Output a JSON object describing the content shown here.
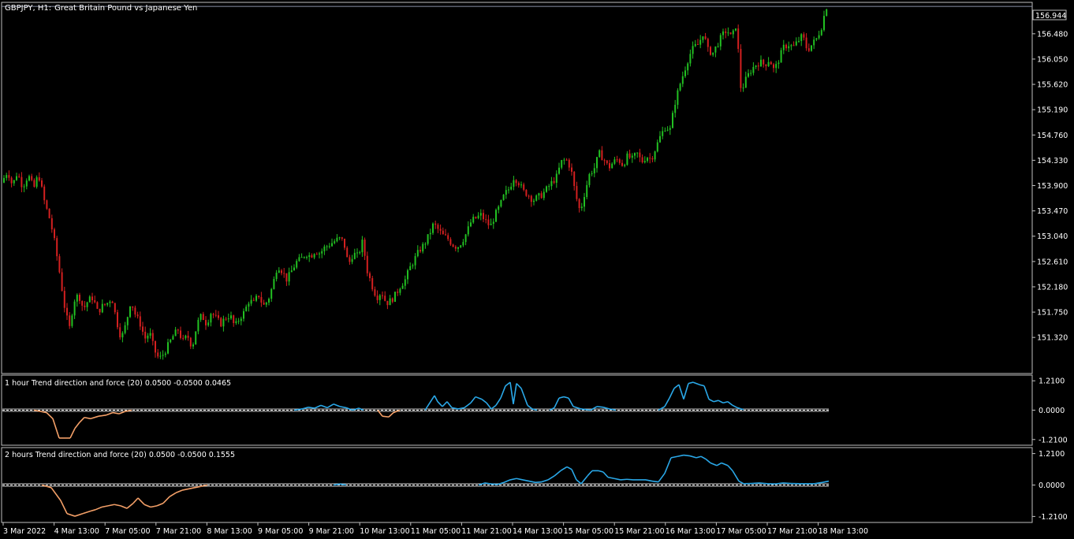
{
  "header": {
    "symbol_timeframe": "GBPJPY, H1:",
    "description": "Great Britain Pound vs Japanese Yen"
  },
  "colors": {
    "background": "#000000",
    "bull_candle": "#22c022",
    "bear_candle": "#d42020",
    "axis_text": "#ffffff",
    "frame": "#c0c0c0",
    "price_line": "#8a8fa6",
    "positive_line": "#2aa8e8",
    "negative_line": "#f4a068",
    "zero_band": "#c0c0c0"
  },
  "main_panel": {
    "current_price": "156.944",
    "y_ticks": [
      "156.480",
      "156.050",
      "155.620",
      "155.190",
      "154.760",
      "154.330",
      "153.900",
      "153.470",
      "153.040",
      "152.610",
      "152.180",
      "151.750",
      "151.320"
    ]
  },
  "indicators": [
    {
      "label": "1 hour Trend direction and force (20) 0.0500 -0.0500 0.0465",
      "y_ticks": [
        "1.2100",
        "0.0000",
        "-1.2100"
      ]
    },
    {
      "label": "2 hours Trend direction and force (20) 0.0500 -0.0500 0.1555",
      "y_ticks": [
        "1.2100",
        "0.0000",
        "-1.2100"
      ]
    }
  ],
  "x_axis": {
    "ticks": [
      "3 Mar 2022",
      "4 Mar 13:00",
      "7 Mar 05:00",
      "7 Mar 21:00",
      "8 Mar 13:00",
      "9 Mar 05:00",
      "9 Mar 21:00",
      "10 Mar 13:00",
      "11 Mar 05:00",
      "11 Mar 21:00",
      "14 Mar 13:00",
      "15 Mar 05:00",
      "15 Mar 21:00",
      "16 Mar 13:00",
      "17 Mar 05:00",
      "17 Mar 21:00",
      "18 Mar 13:00"
    ]
  },
  "chart_data": [
    {
      "type": "candlestick",
      "series_path": [
        [
          0,
          153.95
        ],
        [
          8,
          154.15
        ],
        [
          14,
          153.9
        ],
        [
          20,
          154.12
        ],
        [
          27,
          153.88
        ],
        [
          34,
          154.08
        ],
        [
          41,
          153.85
        ],
        [
          47,
          154.1
        ],
        [
          55,
          153.6
        ],
        [
          62,
          153.3
        ],
        [
          68,
          152.9
        ],
        [
          74,
          152.4
        ],
        [
          80,
          151.85
        ],
        [
          86,
          151.45
        ],
        [
          92,
          151.95
        ],
        [
          98,
          152.05
        ],
        [
          104,
          151.8
        ],
        [
          110,
          151.95
        ],
        [
          116,
          152.0
        ],
        [
          122,
          151.75
        ],
        [
          128,
          151.85
        ],
        [
          134,
          151.9
        ],
        [
          140,
          152.0
        ],
        [
          146,
          151.6
        ],
        [
          152,
          151.3
        ],
        [
          158,
          151.55
        ],
        [
          164,
          151.95
        ],
        [
          170,
          151.7
        ],
        [
          176,
          151.55
        ],
        [
          182,
          151.3
        ],
        [
          188,
          151.4
        ],
        [
          194,
          151.1
        ],
        [
          200,
          150.95
        ],
        [
          206,
          151.05
        ],
        [
          212,
          151.2
        ],
        [
          218,
          151.35
        ],
        [
          224,
          151.45
        ],
        [
          230,
          151.25
        ],
        [
          236,
          151.35
        ],
        [
          242,
          151.15
        ],
        [
          248,
          151.55
        ],
        [
          254,
          151.7
        ],
        [
          260,
          151.55
        ],
        [
          266,
          151.75
        ],
        [
          272,
          151.65
        ],
        [
          278,
          151.55
        ],
        [
          284,
          151.65
        ],
        [
          290,
          151.7
        ],
        [
          296,
          151.5
        ],
        [
          302,
          151.65
        ],
        [
          308,
          151.75
        ],
        [
          314,
          151.95
        ],
        [
          320,
          151.9
        ],
        [
          326,
          152.05
        ],
        [
          332,
          151.85
        ],
        [
          338,
          151.95
        ],
        [
          344,
          152.2
        ],
        [
          350,
          152.55
        ],
        [
          356,
          152.45
        ],
        [
          362,
          152.3
        ],
        [
          368,
          152.45
        ],
        [
          374,
          152.6
        ],
        [
          380,
          152.65
        ],
        [
          386,
          152.75
        ],
        [
          392,
          152.7
        ],
        [
          398,
          152.8
        ],
        [
          404,
          152.75
        ],
        [
          410,
          152.85
        ],
        [
          416,
          152.9
        ],
        [
          422,
          152.95
        ],
        [
          428,
          153.0
        ],
        [
          434,
          152.95
        ],
        [
          440,
          152.55
        ],
        [
          446,
          152.75
        ],
        [
          452,
          152.7
        ],
        [
          458,
          152.95
        ],
        [
          464,
          152.45
        ],
        [
          470,
          152.2
        ],
        [
          476,
          152.0
        ],
        [
          482,
          152.1
        ],
        [
          488,
          151.9
        ],
        [
          494,
          151.95
        ],
        [
          500,
          152.05
        ],
        [
          506,
          152.2
        ],
        [
          512,
          152.3
        ],
        [
          518,
          152.5
        ],
        [
          524,
          152.65
        ],
        [
          530,
          152.8
        ],
        [
          536,
          152.9
        ],
        [
          542,
          153.05
        ],
        [
          548,
          153.25
        ],
        [
          554,
          153.15
        ],
        [
          560,
          153.05
        ],
        [
          566,
          153.0
        ],
        [
          572,
          152.9
        ],
        [
          578,
          152.85
        ],
        [
          584,
          152.95
        ],
        [
          590,
          153.1
        ],
        [
          596,
          153.3
        ],
        [
          602,
          153.35
        ],
        [
          608,
          153.4
        ],
        [
          614,
          153.3
        ],
        [
          620,
          153.2
        ],
        [
          626,
          153.4
        ],
        [
          632,
          153.55
        ],
        [
          638,
          153.75
        ],
        [
          644,
          153.85
        ],
        [
          650,
          154.05
        ],
        [
          656,
          153.95
        ],
        [
          662,
          153.8
        ],
        [
          668,
          153.75
        ],
        [
          674,
          153.65
        ],
        [
          680,
          153.7
        ],
        [
          686,
          153.75
        ],
        [
          692,
          153.85
        ],
        [
          698,
          153.95
        ],
        [
          704,
          154.05
        ],
        [
          710,
          154.3
        ],
        [
          716,
          154.35
        ],
        [
          722,
          154.2
        ],
        [
          728,
          153.75
        ],
        [
          734,
          153.45
        ],
        [
          740,
          153.8
        ],
        [
          746,
          154.1
        ],
        [
          752,
          154.2
        ],
        [
          758,
          154.45
        ],
        [
          764,
          154.35
        ],
        [
          770,
          154.2
        ],
        [
          776,
          154.3
        ],
        [
          782,
          154.35
        ],
        [
          788,
          154.25
        ],
        [
          794,
          154.4
        ],
        [
          800,
          154.35
        ],
        [
          806,
          154.45
        ],
        [
          812,
          154.3
        ],
        [
          818,
          154.4
        ],
        [
          824,
          154.35
        ],
        [
          830,
          154.55
        ],
        [
          836,
          154.75
        ],
        [
          842,
          154.9
        ],
        [
          848,
          154.85
        ],
        [
          854,
          155.3
        ],
        [
          860,
          155.6
        ],
        [
          866,
          155.85
        ],
        [
          872,
          156.1
        ],
        [
          878,
          156.25
        ],
        [
          884,
          156.3
        ],
        [
          890,
          156.5
        ],
        [
          896,
          156.2
        ],
        [
          902,
          156.15
        ],
        [
          908,
          156.3
        ],
        [
          914,
          156.45
        ],
        [
          920,
          156.55
        ],
        [
          926,
          156.4
        ],
        [
          932,
          156.65
        ],
        [
          938,
          155.5
        ],
        [
          944,
          155.7
        ],
        [
          950,
          155.85
        ],
        [
          956,
          155.95
        ],
        [
          962,
          156.0
        ],
        [
          968,
          155.95
        ],
        [
          974,
          156.05
        ],
        [
          980,
          155.85
        ],
        [
          986,
          156.05
        ],
        [
          992,
          156.25
        ],
        [
          998,
          156.3
        ],
        [
          1004,
          156.25
        ],
        [
          1010,
          156.35
        ],
        [
          1016,
          156.45
        ],
        [
          1022,
          156.2
        ],
        [
          1028,
          156.3
        ],
        [
          1034,
          156.4
        ],
        [
          1040,
          156.6
        ],
        [
          1046,
          156.94
        ]
      ]
    },
    {
      "type": "line",
      "name": "1 hour Trend direction and force (20)",
      "series": [
        [
          0,
          0
        ],
        [
          40,
          0
        ],
        [
          56,
          -0.1
        ],
        [
          64,
          -0.35
        ],
        [
          72,
          -1.15
        ],
        [
          78,
          -1.15
        ],
        [
          86,
          -1.15
        ],
        [
          92,
          -0.75
        ],
        [
          98,
          -0.5
        ],
        [
          104,
          -0.3
        ],
        [
          112,
          -0.35
        ],
        [
          122,
          -0.25
        ],
        [
          132,
          -0.2
        ],
        [
          140,
          -0.1
        ],
        [
          148,
          -0.15
        ],
        [
          156,
          -0.05
        ],
        [
          164,
          0
        ],
        [
          370,
          0
        ],
        [
          380,
          0.05
        ],
        [
          388,
          0.12
        ],
        [
          396,
          0.08
        ],
        [
          404,
          0.2
        ],
        [
          412,
          0.1
        ],
        [
          420,
          0.25
        ],
        [
          428,
          0.15
        ],
        [
          436,
          0.1
        ],
        [
          444,
          0
        ],
        [
          452,
          0.08
        ],
        [
          458,
          0
        ],
        [
          476,
          0
        ],
        [
          482,
          -0.25
        ],
        [
          490,
          -0.28
        ],
        [
          496,
          -0.1
        ],
        [
          504,
          0
        ],
        [
          536,
          0
        ],
        [
          542,
          0.3
        ],
        [
          548,
          0.6
        ],
        [
          552,
          0.35
        ],
        [
          558,
          0.15
        ],
        [
          564,
          0.35
        ],
        [
          570,
          0.1
        ],
        [
          578,
          0.05
        ],
        [
          586,
          0.1
        ],
        [
          594,
          0.3
        ],
        [
          600,
          0.55
        ],
        [
          608,
          0.45
        ],
        [
          614,
          0.3
        ],
        [
          620,
          0.05
        ],
        [
          626,
          0.2
        ],
        [
          632,
          0.5
        ],
        [
          638,
          1.0
        ],
        [
          644,
          1.15
        ],
        [
          648,
          0.25
        ],
        [
          652,
          1.1
        ],
        [
          658,
          0.9
        ],
        [
          666,
          0.2
        ],
        [
          672,
          0.05
        ],
        [
          678,
          0
        ],
        [
          694,
          0
        ],
        [
          700,
          0.1
        ],
        [
          706,
          0.5
        ],
        [
          712,
          0.55
        ],
        [
          718,
          0.5
        ],
        [
          724,
          0.15
        ],
        [
          734,
          0.05
        ],
        [
          746,
          0
        ],
        [
          754,
          0.15
        ],
        [
          762,
          0.12
        ],
        [
          770,
          0.05
        ],
        [
          778,
          0
        ],
        [
          832,
          0
        ],
        [
          840,
          0.15
        ],
        [
          846,
          0.5
        ],
        [
          852,
          0.9
        ],
        [
          858,
          1.05
        ],
        [
          864,
          0.45
        ],
        [
          870,
          1.1
        ],
        [
          876,
          1.15
        ],
        [
          884,
          1.05
        ],
        [
          890,
          1.0
        ],
        [
          896,
          0.45
        ],
        [
          902,
          0.35
        ],
        [
          908,
          0.4
        ],
        [
          914,
          0.3
        ],
        [
          920,
          0.35
        ],
        [
          926,
          0.2
        ],
        [
          932,
          0.1
        ],
        [
          940,
          0.02
        ]
      ]
    },
    {
      "type": "line",
      "name": "2 hours Trend direction and force (20)",
      "series": [
        [
          0,
          0
        ],
        [
          50,
          0
        ],
        [
          62,
          -0.1
        ],
        [
          74,
          -0.6
        ],
        [
          82,
          -1.1
        ],
        [
          92,
          -1.2
        ],
        [
          102,
          -1.1
        ],
        [
          112,
          -1.0
        ],
        [
          118,
          -0.95
        ],
        [
          126,
          -0.85
        ],
        [
          134,
          -0.8
        ],
        [
          142,
          -0.75
        ],
        [
          150,
          -0.8
        ],
        [
          158,
          -0.9
        ],
        [
          166,
          -0.7
        ],
        [
          172,
          -0.5
        ],
        [
          180,
          -0.75
        ],
        [
          188,
          -0.85
        ],
        [
          196,
          -0.8
        ],
        [
          204,
          -0.7
        ],
        [
          212,
          -0.45
        ],
        [
          220,
          -0.3
        ],
        [
          228,
          -0.2
        ],
        [
          236,
          -0.15
        ],
        [
          244,
          -0.1
        ],
        [
          252,
          -0.05
        ],
        [
          260,
          0
        ],
        [
          420,
          0
        ],
        [
          428,
          0.04
        ],
        [
          436,
          0
        ],
        [
          604,
          0
        ],
        [
          612,
          0.08
        ],
        [
          620,
          0.04
        ],
        [
          628,
          0.02
        ],
        [
          636,
          0.1
        ],
        [
          644,
          0.2
        ],
        [
          652,
          0.25
        ],
        [
          660,
          0.2
        ],
        [
          668,
          0.15
        ],
        [
          676,
          0.1
        ],
        [
          684,
          0.12
        ],
        [
          692,
          0.2
        ],
        [
          700,
          0.35
        ],
        [
          708,
          0.55
        ],
        [
          716,
          0.7
        ],
        [
          722,
          0.6
        ],
        [
          728,
          0.2
        ],
        [
          734,
          0.05
        ],
        [
          742,
          0.35
        ],
        [
          748,
          0.55
        ],
        [
          756,
          0.55
        ],
        [
          762,
          0.5
        ],
        [
          768,
          0.3
        ],
        [
          776,
          0.25
        ],
        [
          784,
          0.2
        ],
        [
          792,
          0.22
        ],
        [
          800,
          0.2
        ],
        [
          808,
          0.2
        ],
        [
          816,
          0.2
        ],
        [
          824,
          0.15
        ],
        [
          832,
          0.12
        ],
        [
          840,
          0.45
        ],
        [
          848,
          1.05
        ],
        [
          856,
          1.1
        ],
        [
          864,
          1.15
        ],
        [
          872,
          1.12
        ],
        [
          880,
          1.05
        ],
        [
          886,
          1.1
        ],
        [
          892,
          1.0
        ],
        [
          898,
          0.85
        ],
        [
          906,
          0.75
        ],
        [
          912,
          0.85
        ],
        [
          920,
          0.75
        ],
        [
          926,
          0.55
        ],
        [
          934,
          0.15
        ],
        [
          940,
          0.05
        ],
        [
          950,
          0.06
        ],
        [
          960,
          0.08
        ],
        [
          970,
          0.05
        ],
        [
          980,
          0.04
        ],
        [
          990,
          0.08
        ],
        [
          1000,
          0.06
        ],
        [
          1010,
          0.05
        ],
        [
          1020,
          0.05
        ],
        [
          1030,
          0.05
        ],
        [
          1040,
          0.1
        ],
        [
          1048,
          0.15
        ]
      ]
    }
  ]
}
